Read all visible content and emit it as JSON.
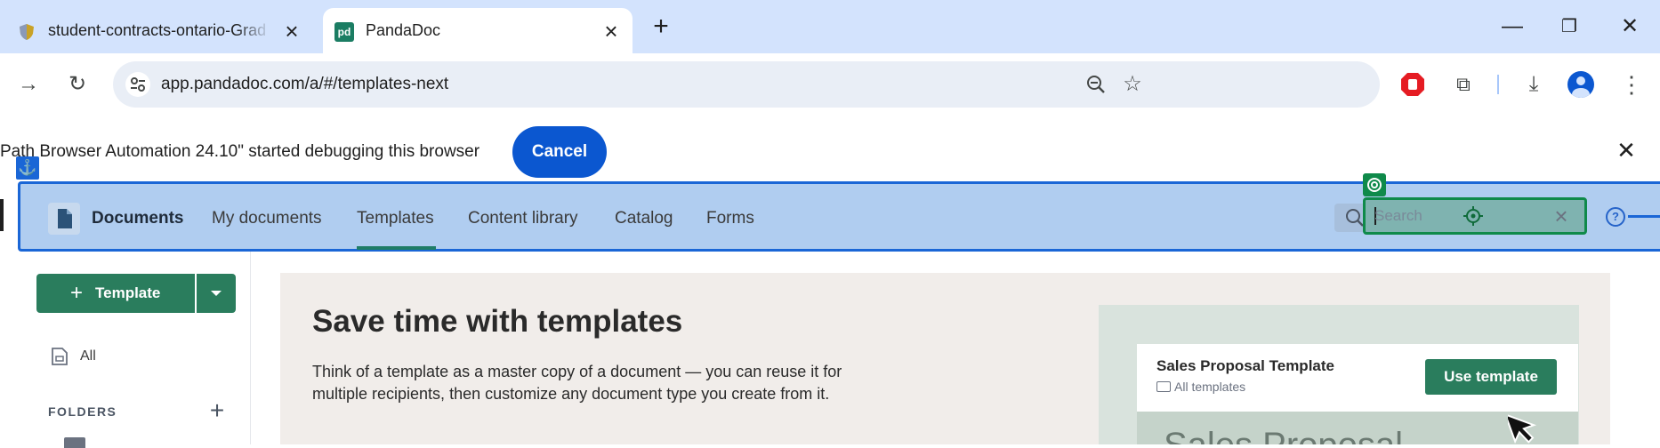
{
  "browser": {
    "tabs": [
      {
        "title": "student-contracts-ontario-Grad",
        "active": false
      },
      {
        "title": "PandaDoc",
        "active": true
      }
    ],
    "new_tab_glyph": "+",
    "window_controls": {
      "minimize": "—",
      "restore": "❐",
      "close": "✕"
    },
    "url": "app.pandadoc.com/a/#/templates-next",
    "accent_color": "#0b57d0"
  },
  "infobar": {
    "message": "Path Browser Automation 24.10\" started debugging this browser",
    "cancel_label": "Cancel"
  },
  "app": {
    "nav": {
      "brand": "Documents",
      "items": [
        {
          "label": "My documents"
        },
        {
          "label": "Templates",
          "active": true
        },
        {
          "label": "Content library"
        },
        {
          "label": "Catalog"
        },
        {
          "label": "Forms"
        }
      ]
    },
    "search": {
      "placeholder": "Search"
    },
    "sidebar": {
      "new_template_label": "Template",
      "all_label": "All",
      "folders_label": "FOLDERS"
    },
    "promo": {
      "title": "Save time with templates",
      "description": "Think of a template as a master copy of a document — you can reuse it for multiple recipients, then customize any document type you create from it.",
      "preview": {
        "title": "Sales Proposal Template",
        "location": "All templates",
        "button_label": "Use template",
        "big_text": "Sales Proposal"
      }
    },
    "brand_color": "#2a7d5d"
  }
}
